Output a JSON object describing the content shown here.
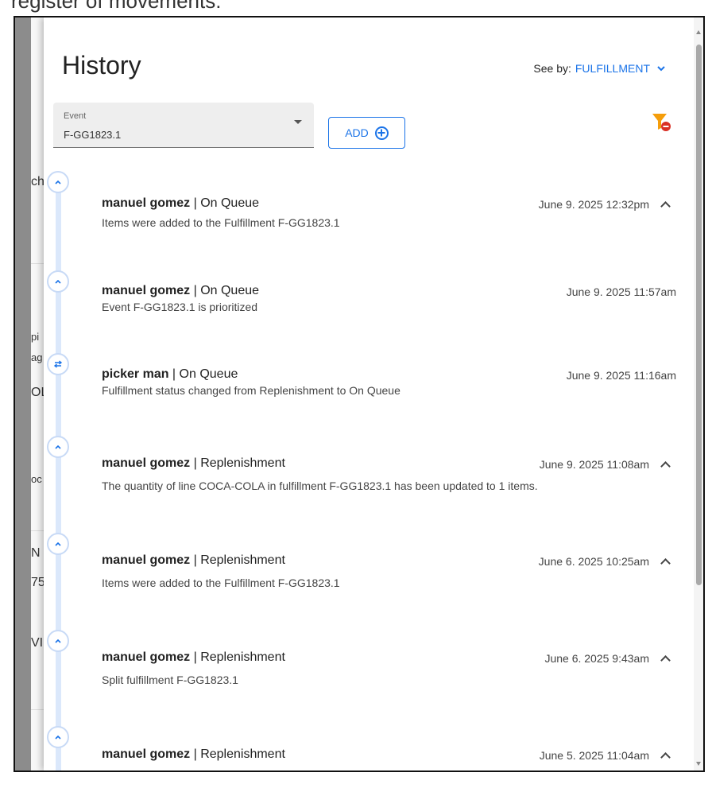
{
  "caption": "register of movements:",
  "background_fragments": [
    "ch",
    "pi",
    "ag",
    "OL",
    "oc",
    "N",
    "75",
    "VIN"
  ],
  "history": {
    "title": "History",
    "see_by_label": "See by:",
    "see_by_value": "FULFILLMENT",
    "event_field": {
      "label": "Event",
      "value": "F-GG1823.1"
    },
    "add_label": "ADD",
    "filter_icon": "filter-clear-icon",
    "colors": {
      "accent": "#1a73e8",
      "filter_icon": "#f59e0b",
      "clear_badge": "#d93025",
      "timeline": "#dbe8fb"
    },
    "entries": [
      {
        "user": "manuel gomez",
        "status": "On Queue",
        "time": "June 9. 2025 12:32pm",
        "desc": "Items were added to the Fulfillment F-GG1823.1",
        "icon": "chevron-up-icon",
        "expand": true
      },
      {
        "user": "manuel gomez",
        "status": "On Queue",
        "time": "June 9. 2025 11:57am",
        "desc": "Event F-GG1823.1 is prioritized",
        "icon": "chevron-up-icon",
        "expand": false
      },
      {
        "user": "picker man",
        "status": "On Queue",
        "time": "June 9. 2025 11:16am",
        "desc": "Fulfillment status changed from Replenishment to On Queue",
        "icon": "swap-arrows-icon",
        "expand": false
      },
      {
        "user": "manuel gomez",
        "status": "Replenishment",
        "time": "June 9. 2025 11:08am",
        "desc": "The quantity of line COCA-COLA in fulfillment F-GG1823.1 has been updated to 1 items.",
        "icon": "chevron-up-icon",
        "expand": true
      },
      {
        "user": "manuel gomez",
        "status": "Replenishment",
        "time": "June 6. 2025 10:25am",
        "desc": "Items were added to the Fulfillment F-GG1823.1",
        "icon": "chevron-up-icon",
        "expand": true
      },
      {
        "user": "manuel gomez",
        "status": "Replenishment",
        "time": "June 6. 2025 9:43am",
        "desc": "Split fulfillment F-GG1823.1",
        "icon": "chevron-up-icon",
        "expand": true
      },
      {
        "user": "manuel gomez",
        "status": "Replenishment",
        "time": "June 5. 2025 11:04am",
        "desc": "",
        "icon": "chevron-up-icon",
        "expand": true
      }
    ]
  }
}
